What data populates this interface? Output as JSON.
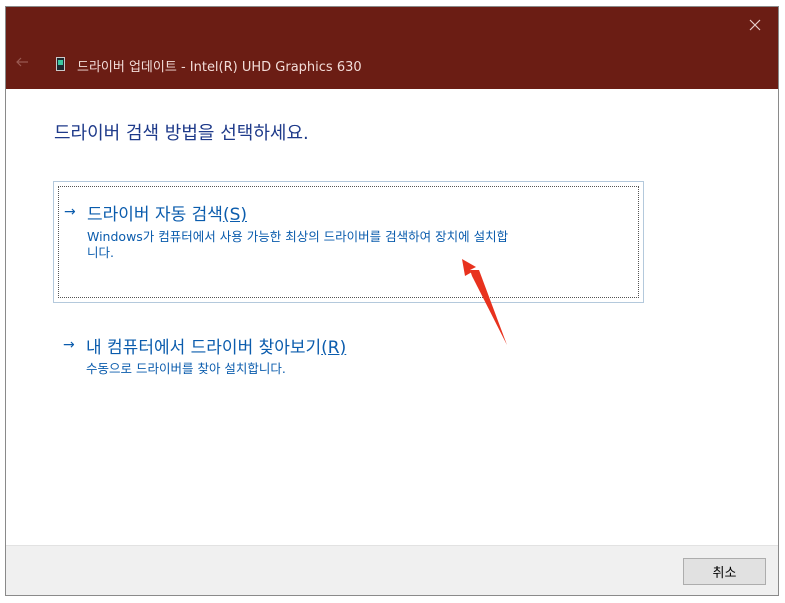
{
  "window": {
    "title": "드라이버 업데이트 - Intel(R) UHD Graphics 630",
    "titlebar_color": "#6b1d14"
  },
  "icons": {
    "close": "close-icon",
    "back": "back-arrow-icon",
    "device": "display-adapter-icon",
    "option_arrow": "arrow-right-icon"
  },
  "main": {
    "heading": "드라이버 검색 방법을 선택하세요.",
    "options": [
      {
        "arrow": "→",
        "title": "드라이버 자동 검색",
        "shortcut": "(S)",
        "description_line1": "Windows가 컴퓨터에서 사용 가능한 최상의 드라이버를 검색하여 장치에 설치합",
        "description_line2": "니다."
      },
      {
        "arrow": "→",
        "title": "내 컴퓨터에서 드라이버 찾아보기",
        "shortcut": "(R)",
        "description_line1": "수동으로 드라이버를 찾아 설치합니다."
      }
    ]
  },
  "footer": {
    "cancel_label": "취소"
  },
  "accent_color": "#0b5cad",
  "annotation_color": "#e8321e"
}
